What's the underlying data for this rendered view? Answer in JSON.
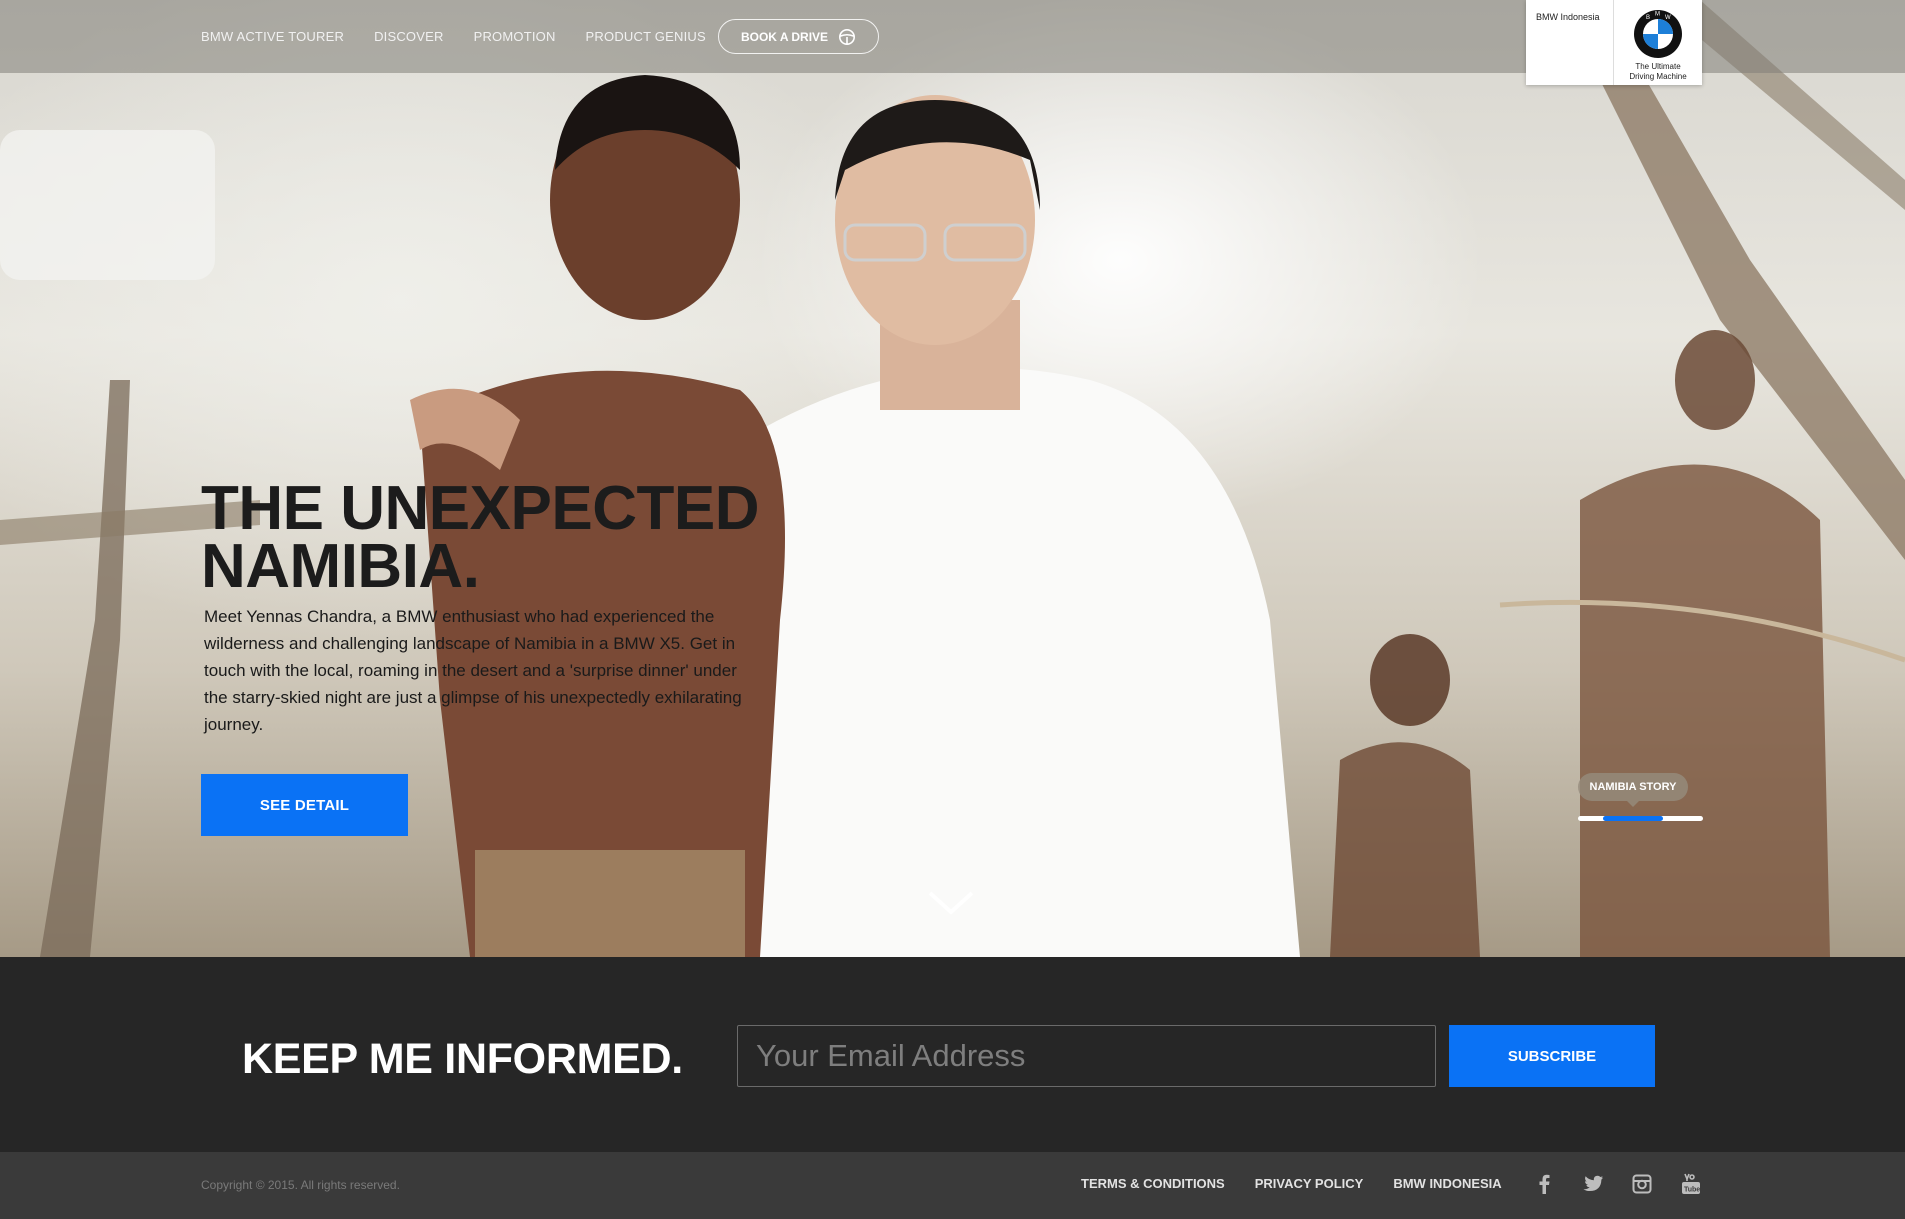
{
  "nav": {
    "items": [
      {
        "label": "BMW ACTIVE TOURER"
      },
      {
        "label": "DISCOVER"
      },
      {
        "label": "PROMOTION"
      },
      {
        "label": "PRODUCT GENIUS"
      }
    ],
    "book_drive": "BOOK A DRIVE",
    "book_drive_icon": "steering-wheel-icon"
  },
  "logo": {
    "brand_text": "BMW Indonesia",
    "roundel_letters": [
      "B",
      "M",
      "W"
    ],
    "tagline_line1": "The Ultimate",
    "tagline_line2": "Driving Machine"
  },
  "hero": {
    "title_line1": "THE UNEXPECTED",
    "title_line2": "NAMIBIA.",
    "description": "Meet Yennas Chandra, a BMW enthusiast who had experienced the wilderness and challenging landscape of Namibia in a BMW X5. Get in touch with the local, roaming in the desert and a 'surprise dinner' under the starry-skied night are just a glimpse of his unexpectedly exhilarating journey.",
    "cta": "SEE DETAIL",
    "story_tag": "NAMIBIA STORY",
    "scroll_icon": "chevron-down-icon"
  },
  "newsletter": {
    "title": "KEEP ME INFORMED.",
    "email_placeholder": "Your Email Address",
    "subscribe": "SUBSCRIBE"
  },
  "footer": {
    "copyright": "Copyright © 2015. All rights reserved.",
    "links": [
      {
        "label": "TERMS & CONDITIONS"
      },
      {
        "label": "PRIVACY POLICY"
      },
      {
        "label": "BMW INDONESIA"
      }
    ],
    "social_icons": [
      "facebook-icon",
      "twitter-icon",
      "instagram-icon",
      "youtube-icon"
    ]
  },
  "colors": {
    "accent": "#0a72f5",
    "dark_band": "#262626",
    "footer": "#3a3a3a"
  }
}
